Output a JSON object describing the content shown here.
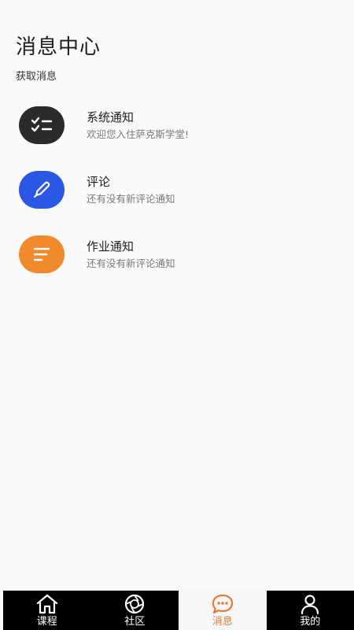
{
  "header": {
    "title": "消息中心",
    "subtitle": "获取消息"
  },
  "messages": [
    {
      "title": "系统通知",
      "desc": "欢迎您入住萨克斯学堂!",
      "icon": "checklist-icon",
      "color": "#2b2b2b"
    },
    {
      "title": "评论",
      "desc": "还有没有新评论通知",
      "icon": "pencil-icon",
      "color": "#2a57e3"
    },
    {
      "title": "作业通知",
      "desc": "还有没有新评论通知",
      "icon": "lines-icon",
      "color": "#f08a2c"
    }
  ],
  "tabbar": {
    "items": [
      {
        "label": "课程",
        "icon": "home-icon"
      },
      {
        "label": "社区",
        "icon": "aperture-icon"
      },
      {
        "label": "消息",
        "icon": "chat-bubble-icon",
        "active": true
      },
      {
        "label": "我的",
        "icon": "user-icon"
      }
    ],
    "active_color": "#e07b39"
  }
}
